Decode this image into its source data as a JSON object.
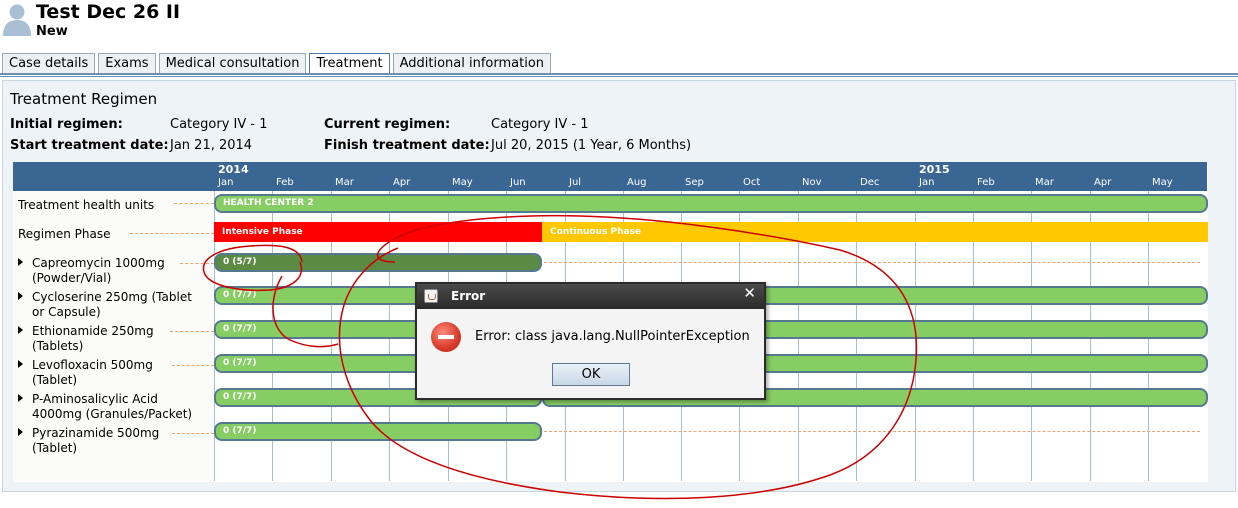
{
  "patient": {
    "name": "Test Dec 26 II",
    "status": "New"
  },
  "tabs": [
    {
      "label": "Case details"
    },
    {
      "label": "Exams"
    },
    {
      "label": "Medical consultation"
    },
    {
      "label": "Treatment"
    },
    {
      "label": "Additional information"
    }
  ],
  "regimen": {
    "title": "Treatment Regimen",
    "initial_label": "Initial regimen:",
    "initial_value": "Category IV - 1",
    "current_label": "Current regimen:",
    "current_value": "Category IV - 1",
    "start_label": "Start treatment date:",
    "start_value": "Jan 21, 2014",
    "finish_label": "Finish treatment date:",
    "finish_value": "Jul 20, 2015 (1 Year, 6 Months)"
  },
  "timeline": {
    "years": [
      "2014",
      "2015"
    ],
    "months": [
      "Jan",
      "Feb",
      "Mar",
      "Apr",
      "May",
      "Jun",
      "Jul",
      "Aug",
      "Sep",
      "Oct",
      "Nov",
      "Dec",
      "Jan",
      "Feb",
      "Mar",
      "Apr",
      "May"
    ]
  },
  "rows": {
    "health_units": {
      "label": "Treatment health units",
      "bar": "HEALTH CENTER 2"
    },
    "phase": {
      "label": "Regimen Phase",
      "intensive": "Intensive Phase",
      "continuous": "Continuous Phase",
      "intensive_color": "#ff0000",
      "continuous_color": "#ffc800"
    },
    "medicines": [
      {
        "line1": "Capreomycin 1000mg",
        "line2": "(Powder/Vial)",
        "bar": "0 (5/7)"
      },
      {
        "line1": "Cycloserine 250mg (Tablet",
        "line2": "or Capsule)",
        "bar": "0 (7/7)"
      },
      {
        "line1": "Ethionamide 250mg",
        "line2": "(Tablets)",
        "bar": "0 (7/7)"
      },
      {
        "line1": "Levofloxacin 500mg",
        "line2": "(Tablet)",
        "bar": "0 (7/7)"
      },
      {
        "line1": "P-Aminosalicylic Acid",
        "line2": "4000mg (Granules/Packet)",
        "bar": "0 (7/7)"
      },
      {
        "line1": "Pyrazinamide 500mg",
        "line2": "(Tablet)",
        "bar": "0 (7/7)"
      }
    ]
  },
  "dialog": {
    "title": "Error",
    "message": "Error: class java.lang.NullPointerException",
    "ok": "OK",
    "close": "✕"
  },
  "colors": {
    "header": "#3a6694",
    "bar_green": "#86cd63",
    "bar_dark": "#5a8a44",
    "annotation": "#cc0000"
  }
}
